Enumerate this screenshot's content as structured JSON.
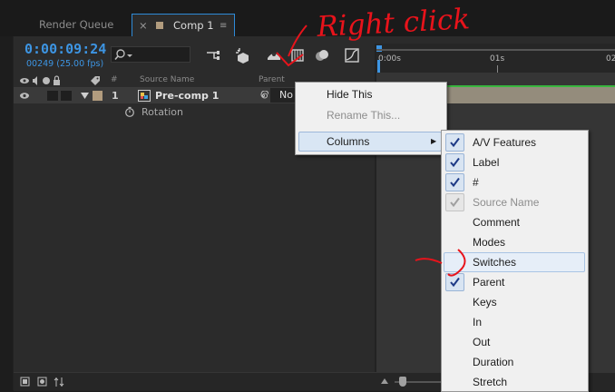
{
  "tabs": {
    "render_queue": "Render Queue",
    "comp_close": "×",
    "comp": "Comp 1",
    "comp_menu": "≡"
  },
  "comp_panel": {
    "timecode": "0:00:09:24",
    "frames_fps": "00249 (25.00 fps)",
    "columns": {
      "number": "#",
      "source_name": "Source Name",
      "parent": "Parent"
    },
    "layer": {
      "number": "1",
      "name": "Pre-comp 1",
      "parent_value": "No"
    },
    "property": {
      "name": "Rotation"
    }
  },
  "timeline": {
    "ruler_labels": [
      "0:00s",
      "01s",
      "02"
    ]
  },
  "context_menu": {
    "items": [
      {
        "label": "Hide This",
        "enabled": true
      },
      {
        "label": "Rename This...",
        "enabled": false
      },
      {
        "label": "Columns",
        "enabled": true,
        "submenu_arrow": "▶"
      }
    ]
  },
  "columns_submenu": {
    "check_mark": "✓",
    "items": [
      {
        "label": "A/V Features",
        "checked": true,
        "enabled": true
      },
      {
        "label": "Label",
        "checked": true,
        "enabled": true
      },
      {
        "label": "#",
        "checked": true,
        "enabled": true
      },
      {
        "label": "Source Name",
        "checked": true,
        "enabled": false
      },
      {
        "label": "Comment",
        "checked": false,
        "enabled": true
      },
      {
        "label": "Modes",
        "checked": false,
        "enabled": true
      },
      {
        "label": "Switches",
        "checked": false,
        "enabled": true,
        "highlighted": true
      },
      {
        "label": "Parent",
        "checked": true,
        "enabled": true
      },
      {
        "label": "Keys",
        "checked": false,
        "enabled": true
      },
      {
        "label": "In",
        "checked": false,
        "enabled": true
      },
      {
        "label": "Out",
        "checked": false,
        "enabled": true
      },
      {
        "label": "Duration",
        "checked": false,
        "enabled": true
      },
      {
        "label": "Stretch",
        "checked": false,
        "enabled": true
      }
    ]
  },
  "annotation": {
    "text": "Right click",
    "color": "#e8131b"
  },
  "colors": {
    "accent_blue": "#3d95e3",
    "label_tan": "#b29c7e",
    "track_green": "#38b63e"
  }
}
